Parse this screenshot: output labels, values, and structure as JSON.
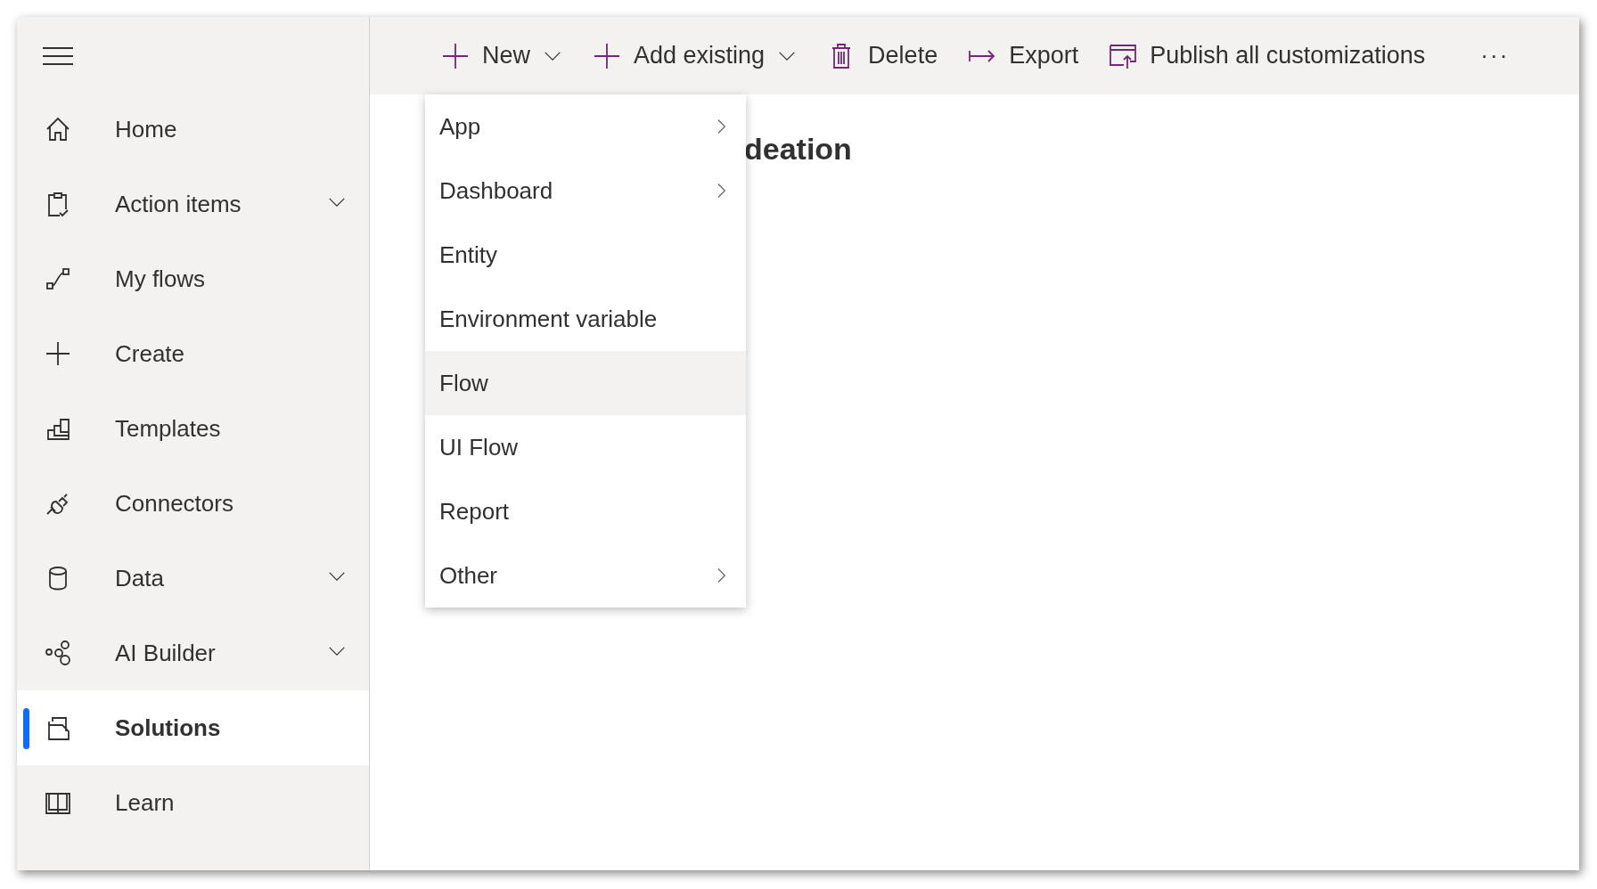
{
  "sidebar": {
    "items": [
      {
        "label": "Home",
        "expandable": false,
        "selected": false
      },
      {
        "label": "Action items",
        "expandable": true,
        "selected": false
      },
      {
        "label": "My flows",
        "expandable": false,
        "selected": false
      },
      {
        "label": "Create",
        "expandable": false,
        "selected": false
      },
      {
        "label": "Templates",
        "expandable": false,
        "selected": false
      },
      {
        "label": "Connectors",
        "expandable": false,
        "selected": false
      },
      {
        "label": "Data",
        "expandable": true,
        "selected": false
      },
      {
        "label": "AI Builder",
        "expandable": true,
        "selected": false
      },
      {
        "label": "Solutions",
        "expandable": false,
        "selected": true
      },
      {
        "label": "Learn",
        "expandable": false,
        "selected": false
      }
    ]
  },
  "toolbar": {
    "buttons": [
      {
        "label": "New",
        "dropdown": true
      },
      {
        "label": "Add existing",
        "dropdown": true
      },
      {
        "label": "Delete",
        "dropdown": false
      },
      {
        "label": "Export",
        "dropdown": false
      },
      {
        "label": "Publish all customizations",
        "dropdown": false
      }
    ],
    "more": "···"
  },
  "page_title": "deation",
  "new_menu": {
    "items": [
      {
        "label": "App",
        "submenu": true,
        "selected": false
      },
      {
        "label": "Dashboard",
        "submenu": true,
        "selected": false
      },
      {
        "label": "Entity",
        "submenu": false,
        "selected": false
      },
      {
        "label": "Environment variable",
        "submenu": false,
        "selected": false
      },
      {
        "label": "Flow",
        "submenu": false,
        "selected": true
      },
      {
        "label": "UI Flow",
        "submenu": false,
        "selected": false
      },
      {
        "label": "Report",
        "submenu": false,
        "selected": false
      },
      {
        "label": "Other",
        "submenu": true,
        "selected": false
      }
    ]
  }
}
